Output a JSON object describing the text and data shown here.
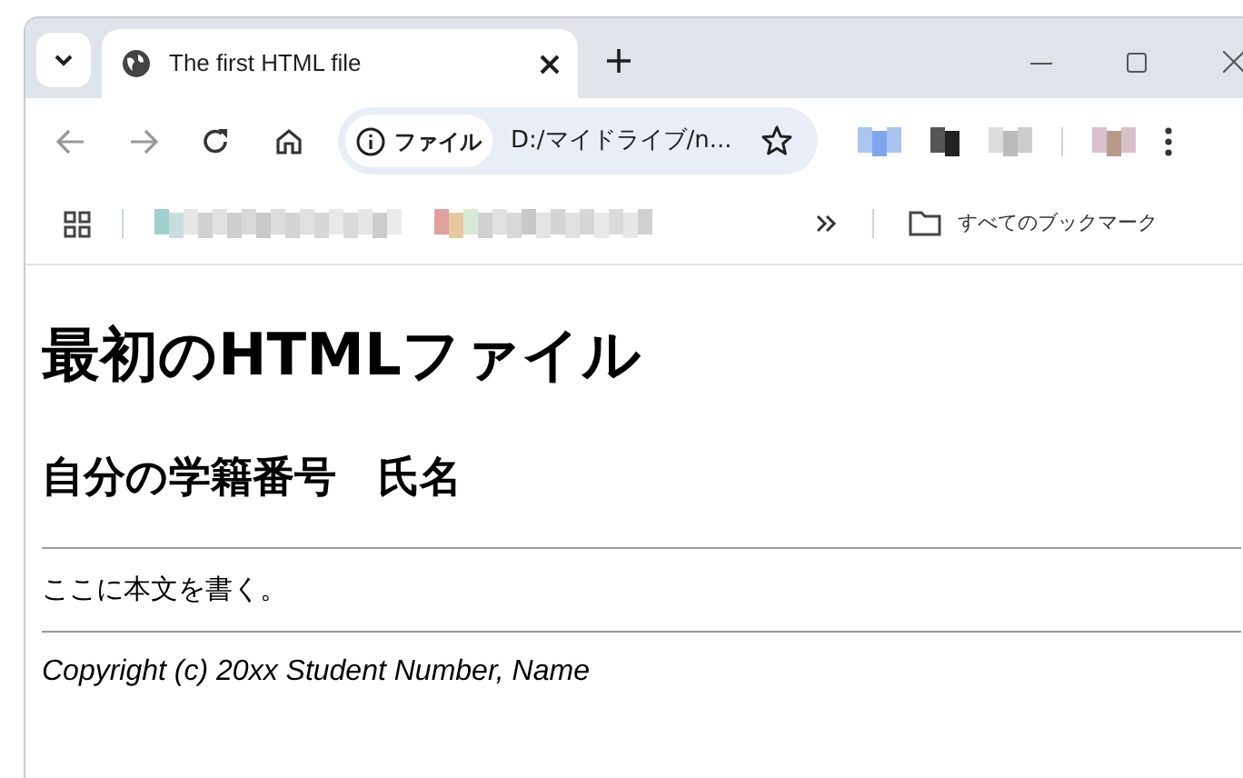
{
  "tab": {
    "title": "The first HTML file",
    "selected": true
  },
  "address_bar": {
    "chip": "ファイル",
    "url": "D:/マイドライブ/n..."
  },
  "bookmarks_bar": {
    "all_bookmarks": "すべてのブックマーク"
  },
  "page": {
    "heading": "最初のHTMLファイル",
    "subheading": "自分の学籍番号　氏名",
    "body": "ここに本文を書く。",
    "footer": "Copyright (c) 20xx Student Number, Name"
  }
}
